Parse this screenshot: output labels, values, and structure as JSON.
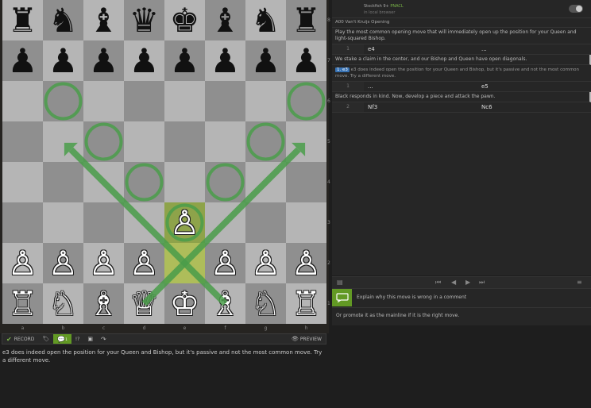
{
  "board": {
    "highlight_squares": [
      "e2",
      "e3"
    ],
    "pieces": [
      {
        "sq": "a8",
        "color": "b",
        "glyph": "♜",
        "name": "black-rook-icon"
      },
      {
        "sq": "b8",
        "color": "b",
        "glyph": "♞",
        "name": "black-knight-icon"
      },
      {
        "sq": "c8",
        "color": "b",
        "glyph": "♝",
        "name": "black-bishop-icon"
      },
      {
        "sq": "d8",
        "color": "b",
        "glyph": "♛",
        "name": "black-queen-icon"
      },
      {
        "sq": "e8",
        "color": "b",
        "glyph": "♚",
        "name": "black-king-icon"
      },
      {
        "sq": "f8",
        "color": "b",
        "glyph": "♝",
        "name": "black-bishop-icon"
      },
      {
        "sq": "g8",
        "color": "b",
        "glyph": "♞",
        "name": "black-knight-icon"
      },
      {
        "sq": "h8",
        "color": "b",
        "glyph": "♜",
        "name": "black-rook-icon"
      },
      {
        "sq": "a7",
        "color": "b",
        "glyph": "♟",
        "name": "black-pawn-icon"
      },
      {
        "sq": "b7",
        "color": "b",
        "glyph": "♟",
        "name": "black-pawn-icon"
      },
      {
        "sq": "c7",
        "color": "b",
        "glyph": "♟",
        "name": "black-pawn-icon"
      },
      {
        "sq": "d7",
        "color": "b",
        "glyph": "♟",
        "name": "black-pawn-icon"
      },
      {
        "sq": "e7",
        "color": "b",
        "glyph": "♟",
        "name": "black-pawn-icon"
      },
      {
        "sq": "f7",
        "color": "b",
        "glyph": "♟",
        "name": "black-pawn-icon"
      },
      {
        "sq": "g7",
        "color": "b",
        "glyph": "♟",
        "name": "black-pawn-icon"
      },
      {
        "sq": "h7",
        "color": "b",
        "glyph": "♟",
        "name": "black-pawn-icon"
      },
      {
        "sq": "e3",
        "color": "w",
        "glyph": "♙",
        "name": "white-pawn-icon"
      },
      {
        "sq": "a2",
        "color": "w",
        "glyph": "♙",
        "name": "white-pawn-icon"
      },
      {
        "sq": "b2",
        "color": "w",
        "glyph": "♙",
        "name": "white-pawn-icon"
      },
      {
        "sq": "c2",
        "color": "w",
        "glyph": "♙",
        "name": "white-pawn-icon"
      },
      {
        "sq": "d2",
        "color": "w",
        "glyph": "♙",
        "name": "white-pawn-icon"
      },
      {
        "sq": "f2",
        "color": "w",
        "glyph": "♙",
        "name": "white-pawn-icon"
      },
      {
        "sq": "g2",
        "color": "w",
        "glyph": "♙",
        "name": "white-pawn-icon"
      },
      {
        "sq": "h2",
        "color": "w",
        "glyph": "♙",
        "name": "white-pawn-icon"
      },
      {
        "sq": "a1",
        "color": "w",
        "glyph": "♖",
        "name": "white-rook-icon"
      },
      {
        "sq": "b1",
        "color": "w",
        "glyph": "♘",
        "name": "white-knight-icon"
      },
      {
        "sq": "c1",
        "color": "w",
        "glyph": "♗",
        "name": "white-bishop-icon"
      },
      {
        "sq": "d1",
        "color": "w",
        "glyph": "♕",
        "name": "white-queen-icon"
      },
      {
        "sq": "e1",
        "color": "w",
        "glyph": "♔",
        "name": "white-king-icon"
      },
      {
        "sq": "f1",
        "color": "w",
        "glyph": "♗",
        "name": "white-bishop-icon"
      },
      {
        "sq": "g1",
        "color": "w",
        "glyph": "♘",
        "name": "white-knight-icon"
      },
      {
        "sq": "h1",
        "color": "w",
        "glyph": "♖",
        "name": "white-rook-icon"
      }
    ],
    "arrows": [
      {
        "from": "d1",
        "to": "a4"
      },
      {
        "from": "f1",
        "to": "a6"
      }
    ],
    "circles": [
      "b6",
      "c5",
      "d4",
      "e3",
      "f4",
      "g5",
      "h6"
    ],
    "arrow_color": "#4a9d4a",
    "files": [
      "a",
      "b",
      "c",
      "d",
      "e",
      "f",
      "g",
      "h"
    ],
    "ranks": [
      "8",
      "7",
      "6",
      "5",
      "4",
      "3",
      "2",
      "1"
    ]
  },
  "toolbar": {
    "record_label": "RECORD",
    "comment_badge": "1",
    "preview_label": "PREVIEW"
  },
  "comment_text": "e3 does indeed open the position for your Queen and Bishop, but it's passive and not the most common move. Try a different move.",
  "engine": {
    "name": "Stockfish 9+",
    "tag": "PNACL",
    "sub": "in local browser"
  },
  "moves": {
    "opening": "A00 Van't Kruijs Opening",
    "intro_comment": "Play the most common opening move that will immediately open up the position for your Queen and light-squared Bishop.",
    "row1": {
      "num": "1",
      "white": "e4",
      "black": "..."
    },
    "comment_after_e4": "We stake a claim in the center, and our Bishop and Queen have open diagonals.",
    "variation": {
      "move": "1. e3",
      "text": "e3 does indeed open the position for your Queen and Bishop, but it's passive and not the most common move. Try a different move."
    },
    "row1b": {
      "num": "1",
      "white": "...",
      "black": "e5"
    },
    "comment_after_e5": "Black responds in kind. Now, develop a piece and attack the pawn.",
    "row2": {
      "num": "2",
      "white": "Nf3",
      "black": "Nc6"
    }
  },
  "practice": {
    "explain": "Explain why this move is wrong in a comment",
    "promote": "Or promote it as the mainline if it is the right move."
  }
}
